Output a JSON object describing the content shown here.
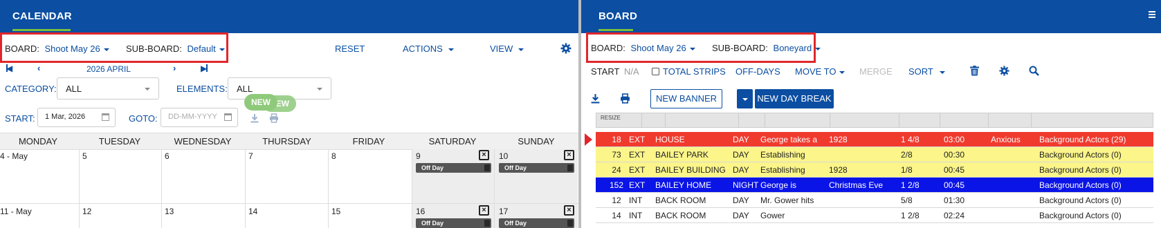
{
  "calendar": {
    "title": "CALENDAR",
    "board_label": "BOARD:",
    "board_value": "Shoot May 26",
    "subboard_label": "SUB-BOARD:",
    "subboard_value": "Default",
    "reset": "RESET",
    "actions": "ACTIONS",
    "view": "VIEW",
    "month": "2026 APRIL",
    "category_label": "CATEGORY:",
    "category_value": "ALL",
    "elements_label": "ELEMENTS:",
    "elements_value": "ALL",
    "start_label": "START:",
    "start_value": "1 Mar, 2026",
    "goto_label": "GOTO:",
    "goto_placeholder": "DD-MM-YYYY",
    "new_badge_1": "NEW",
    "new_badge_2": "NEW",
    "days": [
      "MONDAY",
      "TUESDAY",
      "WEDNESDAY",
      "THURSDAY",
      "FRIDAY",
      "SATURDAY",
      "SUNDAY"
    ],
    "week1": [
      "4 - May",
      "5",
      "6",
      "7",
      "8",
      "9",
      "10"
    ],
    "week2": [
      "11 - May",
      "12",
      "13",
      "14",
      "15",
      "16",
      "17"
    ],
    "offday_label": "Off Day"
  },
  "board": {
    "title": "BOARD",
    "board_label": "BOARD:",
    "board_value": "Shoot May 26",
    "subboard_label": "SUB-BOARD:",
    "subboard_value": "Boneyard",
    "start_label": "START",
    "start_value": "N/A",
    "total_strips": "TOTAL STRIPS",
    "off_days": "OFF-DAYS",
    "move_to": "MOVE TO",
    "merge": "MERGE",
    "sort": "SORT",
    "new_banner": "NEW BANNER",
    "new_day_break": "NEW DAY BREAK",
    "resize": "RESIZE",
    "strips": [
      {
        "scene": "18",
        "ie": "EXT",
        "set": "HOUSE",
        "dn": "DAY",
        "synopsis": "George takes a",
        "extra": "1928",
        "pages": "1 4/8",
        "time": "03:00",
        "mood": "Anxious",
        "cast": "Background Actors (29)",
        "color": "#f03a2e",
        "text": "#ffffff"
      },
      {
        "scene": "73",
        "ie": "EXT",
        "set": "BAILEY PARK",
        "dn": "DAY",
        "synopsis": "Establishing",
        "extra": "",
        "pages": "2/8",
        "time": "00:30",
        "mood": "",
        "cast": "Background Actors (0)",
        "color": "#fbf58a",
        "text": "#222222"
      },
      {
        "scene": "24",
        "ie": "EXT",
        "set": "BAILEY BUILDING",
        "dn": "DAY",
        "synopsis": "Establishing",
        "extra": "1928",
        "pages": "1/8",
        "time": "00:45",
        "mood": "",
        "cast": "Background Actors (0)",
        "color": "#fbf58a",
        "text": "#222222"
      },
      {
        "scene": "152",
        "ie": "EXT",
        "set": "BAILEY HOME",
        "dn": "NIGHT",
        "synopsis": "George is",
        "extra": "Christmas Eve",
        "pages": "1 2/8",
        "time": "00:45",
        "mood": "",
        "cast": "Background Actors (0)",
        "color": "#0a14e6",
        "text": "#ffffff"
      },
      {
        "scene": "12",
        "ie": "INT",
        "set": "BACK ROOM",
        "dn": "DAY",
        "synopsis": "Mr. Gower hits",
        "extra": "",
        "pages": "5/8",
        "time": "01:30",
        "mood": "",
        "cast": "Background Actors (0)",
        "color": "#ffffff",
        "text": "#222222"
      },
      {
        "scene": "14",
        "ie": "INT",
        "set": "BACK ROOM",
        "dn": "DAY",
        "synopsis": "Gower",
        "extra": "",
        "pages": "1 2/8",
        "time": "02:24",
        "mood": "",
        "cast": "Background Actors (0)",
        "color": "#ffffff",
        "text": "#222222"
      }
    ]
  },
  "colors": {
    "brand_blue": "#0b4ea2",
    "accent_green": "#7bbf3c",
    "highlight_red": "#e0262b"
  }
}
